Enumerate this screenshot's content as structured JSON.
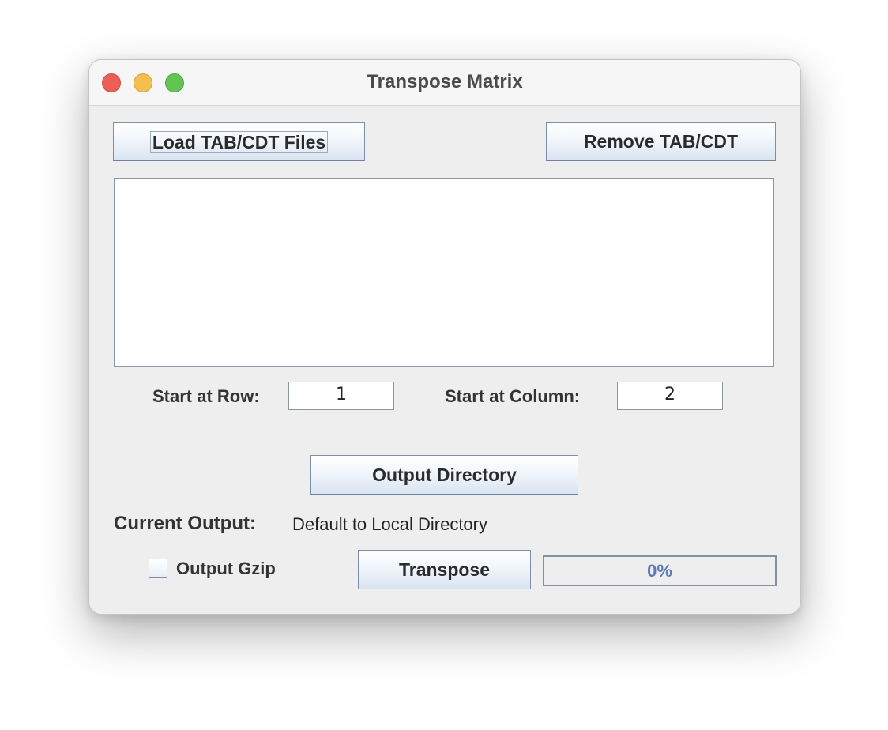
{
  "window": {
    "title": "Transpose Matrix"
  },
  "buttons": {
    "load_label": "Load TAB/CDT Files",
    "remove_label": "Remove TAB/CDT",
    "output_dir_label": "Output Directory",
    "transpose_label": "Transpose"
  },
  "files": {
    "items": []
  },
  "start_row": {
    "label": "Start at Row:",
    "value": "1"
  },
  "start_column": {
    "label": "Start at Column:",
    "value": "2"
  },
  "output": {
    "label": "Current Output:",
    "value": "Default to Local Directory"
  },
  "gzip": {
    "label": "Output Gzip",
    "checked": false
  },
  "progress": {
    "text": "0%",
    "value": 0
  },
  "colors": {
    "window_bg": "#eeeeee",
    "progress_text": "#5b7bb6",
    "close": "#ec5f58",
    "minimize": "#f5bf4f",
    "zoom": "#61c554"
  }
}
